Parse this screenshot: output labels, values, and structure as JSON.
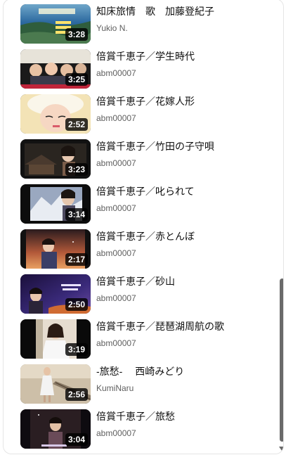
{
  "videos": [
    {
      "title": "知床旅情　歌　加藤登紀子",
      "channel": "Yukio N.",
      "duration": "3:28",
      "thumb": "thumb-sea-coast"
    },
    {
      "title": "倍賞千恵子／学生時代",
      "channel": "abm00007",
      "duration": "3:25",
      "thumb": "thumb-group-photo"
    },
    {
      "title": "倍賞千恵子／花嫁人形",
      "channel": "abm00007",
      "duration": "2:52",
      "thumb": "thumb-bride"
    },
    {
      "title": "倍賞千恵子／竹田の子守唄",
      "channel": "abm00007",
      "duration": "3:23",
      "thumb": "thumb-village-singer"
    },
    {
      "title": "倍賞千恵子／叱られて",
      "channel": "abm00007",
      "duration": "3:14",
      "thumb": "thumb-mountain-singer"
    },
    {
      "title": "倍賞千恵子／赤とんぼ",
      "channel": "abm00007",
      "duration": "2:17",
      "thumb": "thumb-sunset-kimono"
    },
    {
      "title": "倍賞千恵子／砂山",
      "channel": "abm00007",
      "duration": "2:50",
      "thumb": "thumb-night-singer"
    },
    {
      "title": "倍賞千恵子／琵琶湖周航の歌",
      "channel": "abm00007",
      "duration": "3:19",
      "thumb": "thumb-white-dress"
    },
    {
      "title": "-旅愁-　 西崎みどり",
      "channel": "KumiNaru",
      "duration": "2:56",
      "thumb": "thumb-rail-track"
    },
    {
      "title": "倍賞千恵子／旅愁",
      "channel": "abm00007",
      "duration": "3:04",
      "thumb": "thumb-dark-singer"
    }
  ],
  "colors": {
    "title": "#0f0f0f",
    "channel": "#606060",
    "scrollbar": "#6a6a6a"
  }
}
